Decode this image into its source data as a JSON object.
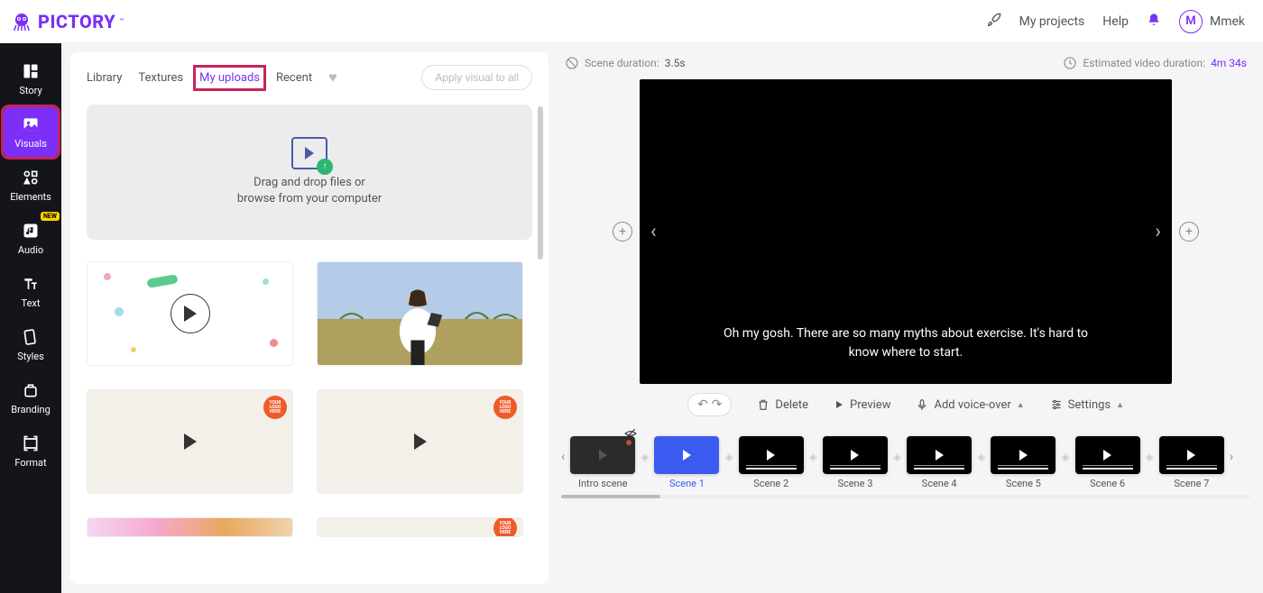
{
  "header": {
    "brand": "PICTORY",
    "tm": "™",
    "nav": {
      "projects": "My projects",
      "help": "Help"
    },
    "user": {
      "initial": "M",
      "name": "Mmek"
    }
  },
  "sidebar": {
    "items": [
      {
        "label": "Story"
      },
      {
        "label": "Visuals"
      },
      {
        "label": "Elements"
      },
      {
        "label": "Audio",
        "badge": "NEW"
      },
      {
        "label": "Text"
      },
      {
        "label": "Styles"
      },
      {
        "label": "Branding"
      },
      {
        "label": "Format"
      }
    ]
  },
  "visuals": {
    "tabs": {
      "library": "Library",
      "textures": "Textures",
      "uploads": "My uploads",
      "recent": "Recent"
    },
    "apply_all": "Apply visual to all",
    "drop_line1": "Drag and drop files or",
    "drop_line2": "browse from your computer",
    "logo_badge": "YOUR LOGO HERE"
  },
  "preview": {
    "scene_duration_label": "Scene duration:",
    "scene_duration_value": "3.5s",
    "est_label": "Estimated video duration:",
    "est_value": "4m 34s",
    "caption_line1": "Oh my gosh. There are so many myths about exercise. It's hard to",
    "caption_line2": "know where to start.",
    "toolbar": {
      "delete": "Delete",
      "preview": "Preview",
      "voice": "Add voice-over",
      "settings": "Settings"
    }
  },
  "timeline": {
    "items": [
      {
        "label": "Intro scene"
      },
      {
        "label": "Scene 1"
      },
      {
        "label": "Scene 2"
      },
      {
        "label": "Scene 3"
      },
      {
        "label": "Scene 4"
      },
      {
        "label": "Scene 5"
      },
      {
        "label": "Scene 6"
      },
      {
        "label": "Scene 7"
      }
    ]
  }
}
